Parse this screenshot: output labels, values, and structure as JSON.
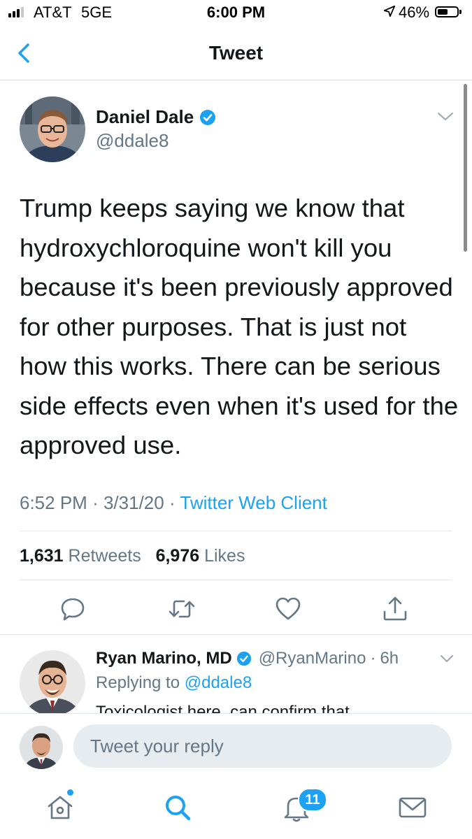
{
  "status_bar": {
    "carrier": "AT&T",
    "network": "5GE",
    "time": "6:00 PM",
    "battery": "46%",
    "icons": [
      "signal-icon",
      "location-arrow-icon",
      "battery-icon"
    ]
  },
  "nav": {
    "title": "Tweet",
    "back_icon": "chevron-left-icon"
  },
  "tweet": {
    "author_name": "Daniel Dale",
    "author_handle": "@ddale8",
    "verified": true,
    "text": "Trump keeps saying we know that hydroxychloroquine won't kill you because it's been previously approved for other purposes. That is just not how this works. There can be serious side effects even when it's used for the approved use.",
    "time": "6:52 PM",
    "date": "3/31/20",
    "separator": "·",
    "client": "Twitter Web Client",
    "retweets_count": "1,631",
    "retweets_label": "Retweets",
    "likes_count": "6,976",
    "likes_label": "Likes",
    "actions": [
      "reply-icon",
      "retweet-icon",
      "like-icon",
      "share-icon"
    ]
  },
  "reply": {
    "author_name": "Ryan Marino, MD",
    "author_handle": "@RyanMarino",
    "separator": "·",
    "age": "6h",
    "replying_label": "Replying to",
    "replying_to": "@ddale8",
    "text_partial": "Toxicologist here, can confirm that"
  },
  "compose": {
    "placeholder": "Tweet your reply"
  },
  "tabbar": {
    "tabs": [
      "home-icon",
      "search-icon",
      "notifications-icon",
      "messages-icon"
    ],
    "notifications_badge": "11"
  },
  "colors": {
    "accent": "#1da1f2",
    "secondary_text": "#657786",
    "primary_text": "#14171a",
    "divider": "#e1e8ed"
  }
}
